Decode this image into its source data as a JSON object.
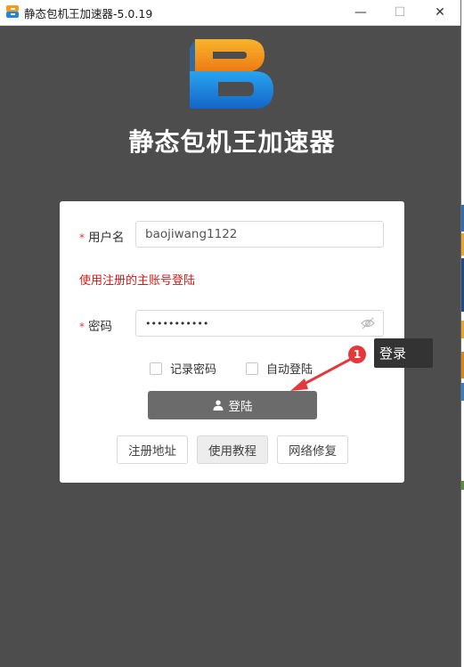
{
  "window": {
    "title": "静态包机王加速器-5.0.19",
    "controls": {
      "minimize": "—",
      "maximize": "☐",
      "close": "✕"
    }
  },
  "app": {
    "name": "静态包机王加速器",
    "logo_letter": "B"
  },
  "form": {
    "username_label": "用户名",
    "username_value": "baojiwang1122",
    "hint": "使用注册的主账号登陆",
    "password_label": "密码",
    "password_value": "•••••••••••",
    "required_mark": "*",
    "remember_password": "记录密码",
    "auto_login": "自动登陆",
    "remember_checked": false,
    "auto_login_checked": false,
    "login_button": "登陆"
  },
  "links": {
    "register_address": "注册地址",
    "tutorial": "使用教程",
    "network_repair": "网络修复"
  },
  "annotation": {
    "step_number": "1",
    "tooltip": "登录"
  },
  "colors": {
    "background": "#4d4d4d",
    "card": "#ffffff",
    "required": "#e4393c",
    "hint": "#d11a1a",
    "login_button": "#6b6b6b",
    "badge": "#e4393c",
    "tooltip": "#333333",
    "logo_orange": "#f39a1e",
    "logo_blue": "#1f87e0"
  },
  "icons": {
    "eye": "eye-off-icon",
    "user": "user-icon"
  }
}
